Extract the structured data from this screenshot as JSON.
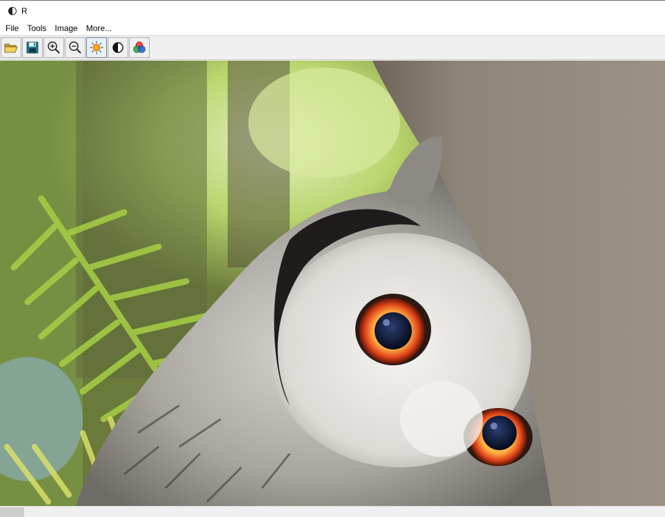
{
  "window": {
    "title": "R"
  },
  "menu": {
    "items": [
      "File",
      "Tools",
      "Image",
      "More..."
    ]
  },
  "toolbar": {
    "buttons": [
      {
        "name": "open-folder-icon",
        "active": false
      },
      {
        "name": "save-disk-icon",
        "active": false
      },
      {
        "name": "zoom-in-icon",
        "active": false
      },
      {
        "name": "zoom-out-icon",
        "active": false
      },
      {
        "name": "brightness-sun-icon",
        "active": true
      },
      {
        "name": "contrast-icon",
        "active": false
      },
      {
        "name": "color-channels-icon",
        "active": false
      }
    ]
  },
  "image": {
    "subject": "owl photograph"
  },
  "colors": {
    "accent_active": "#e5f1fb",
    "owl_eye": "#d9451c",
    "foliage": "#8fc23a"
  }
}
